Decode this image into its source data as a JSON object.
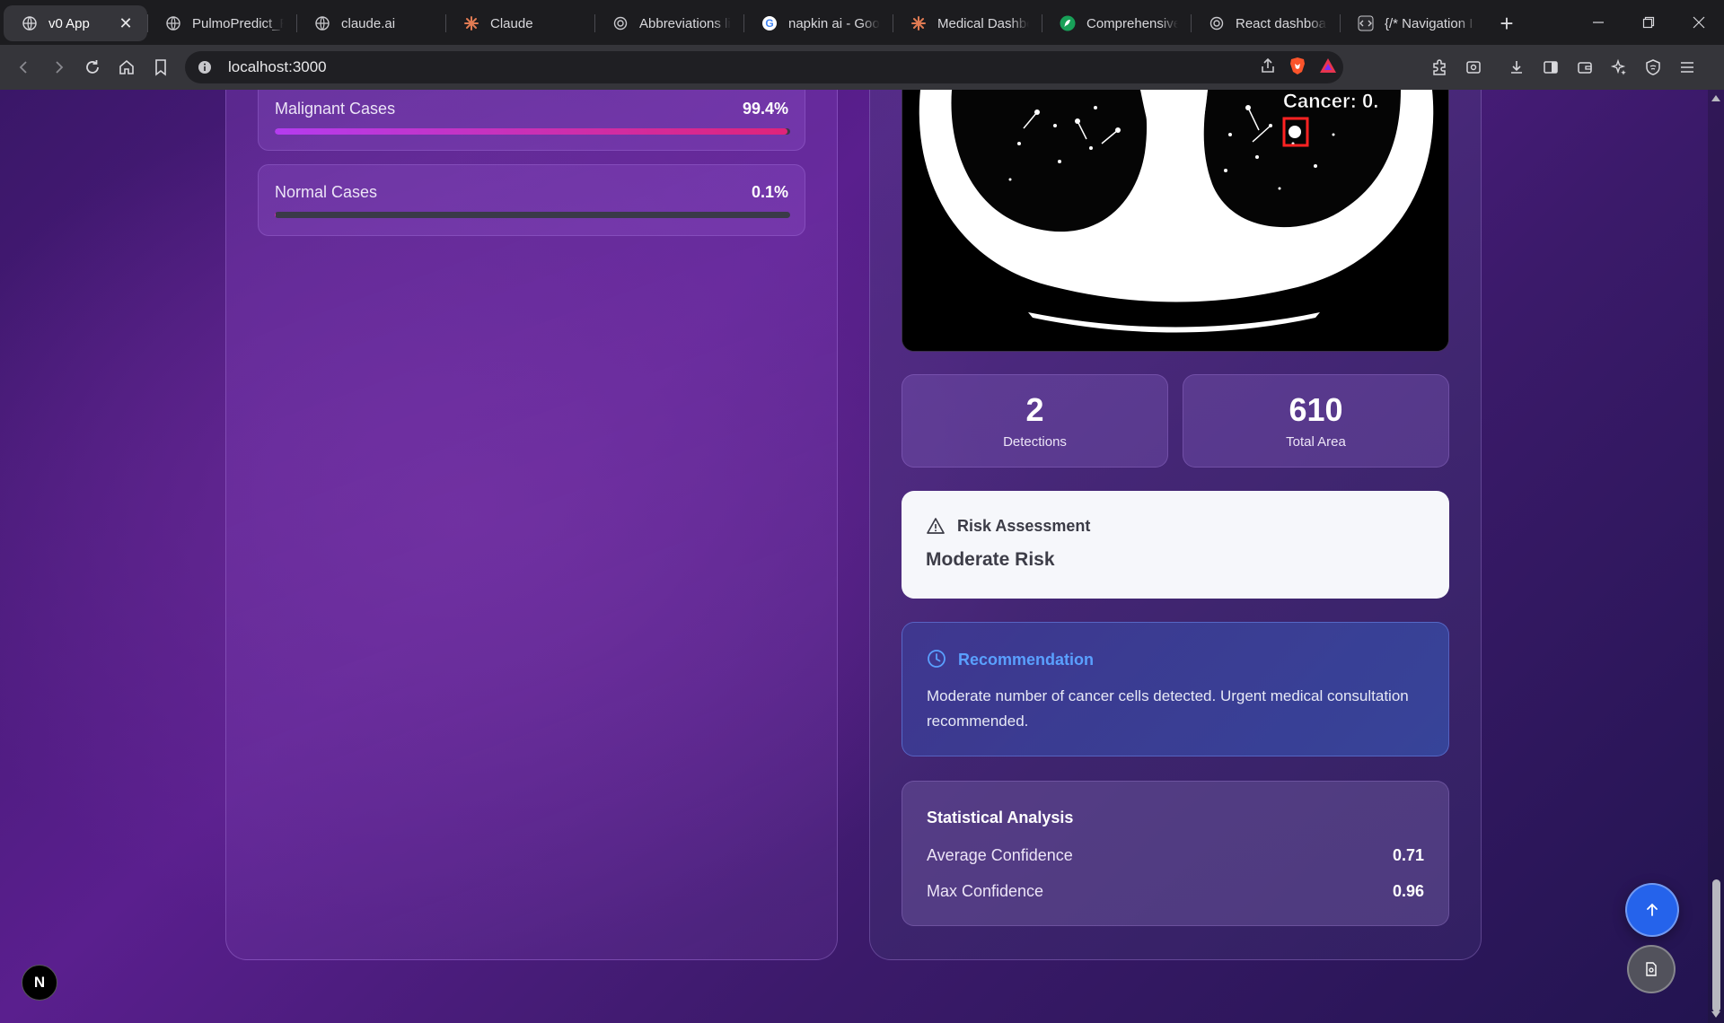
{
  "browser": {
    "tabs": [
      {
        "title": "v0 App",
        "icon": "globe-icon",
        "active": true
      },
      {
        "title": "PulmoPredict_R",
        "icon": "globe-icon"
      },
      {
        "title": "claude.ai",
        "icon": "globe-icon"
      },
      {
        "title": "Claude",
        "icon": "claude-icon"
      },
      {
        "title": "Abbreviations li",
        "icon": "openai-icon"
      },
      {
        "title": "napkin ai - Goo",
        "icon": "google-icon"
      },
      {
        "title": "Medical Dashbo",
        "icon": "claude-icon"
      },
      {
        "title": "Comprehensive",
        "icon": "feather-icon"
      },
      {
        "title": "React dashboar",
        "icon": "openai-icon"
      },
      {
        "title": "{/* Navigation I",
        "icon": "code-icon"
      }
    ],
    "close_glyph": "✕",
    "new_tab_glyph": "+",
    "url": "localhost:3000"
  },
  "left_panel": {
    "malignant": {
      "label": "Malignant Cases",
      "value": "99.4%",
      "fraction": 0.994
    },
    "normal": {
      "label": "Normal Cases",
      "value": "0.1%",
      "fraction": 0.001
    }
  },
  "scan": {
    "overlay_label": "Cancer: 0."
  },
  "metrics": {
    "detections": {
      "value": "2",
      "label": "Detections"
    },
    "total_area": {
      "value": "610",
      "label": "Total Area"
    }
  },
  "risk": {
    "title": "Risk Assessment",
    "level": "Moderate Risk"
  },
  "recommendation": {
    "title": "Recommendation",
    "body": "Moderate number of cancer cells detected. Urgent medical consultation recommended."
  },
  "statistics": {
    "title": "Statistical Analysis",
    "rows": [
      {
        "label": "Average Confidence",
        "value": "0.71"
      },
      {
        "label": "Max Confidence",
        "value": "0.96"
      }
    ]
  },
  "badge": {
    "letter": "N"
  },
  "colors": {
    "accent_blue": "#2563eb",
    "recommendation_title": "#5aa0ff",
    "bar_gradient_start": "#b43cf0",
    "bar_gradient_end": "#e0247a"
  }
}
